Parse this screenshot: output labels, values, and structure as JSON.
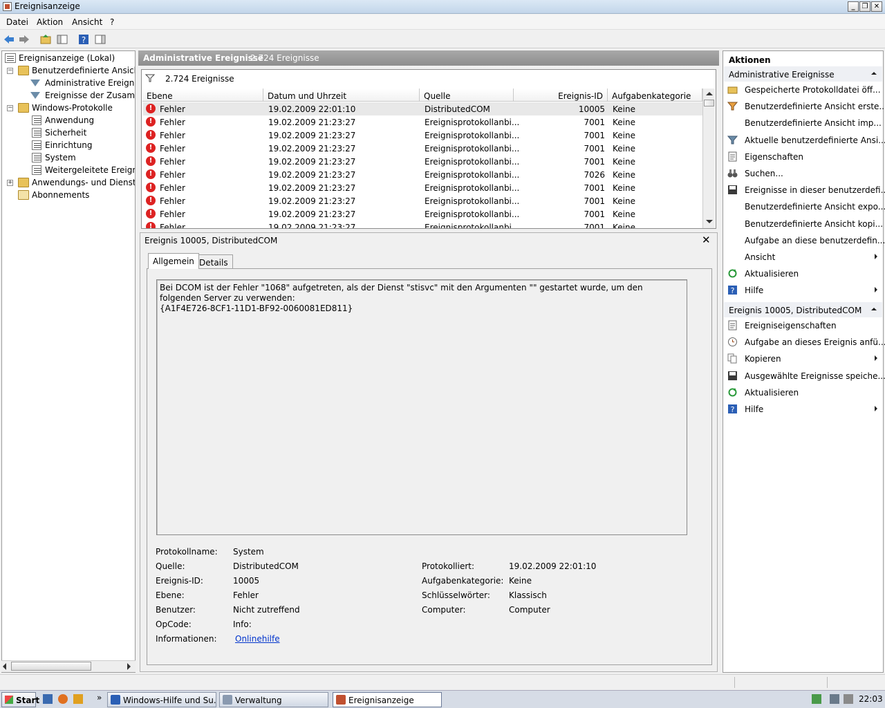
{
  "window": {
    "title": "Ereignisanzeige"
  },
  "menu": [
    "Datei",
    "Aktion",
    "Ansicht",
    "?"
  ],
  "tree": {
    "root": "Ereignisanzeige (Lokal)",
    "custom_views": "Benutzerdefinierte Ansichten",
    "admin_events": "Administrative Ereignisse",
    "summary_events": "Ereignisse der Zusammenfassung",
    "windows_logs": "Windows-Protokolle",
    "app": "Anwendung",
    "security": "Sicherheit",
    "setup": "Einrichtung",
    "system": "System",
    "forwarded": "Weitergeleitete Ereignisse",
    "app_services": "Anwendungs- und Dienstprotokolle",
    "subscriptions": "Abonnements"
  },
  "center": {
    "header_title": "Administrative Ereignisse",
    "header_count": "2.724 Ereignisse",
    "filter_count": "2.724 Ereignisse",
    "columns": [
      "Ebene",
      "Datum und Uhrzeit",
      "Quelle",
      "Ereignis-ID",
      "Aufgabenkategorie"
    ],
    "rows": [
      {
        "level": "Fehler",
        "date": "19.02.2009 22:01:10",
        "source": "DistributedCOM",
        "id": "10005",
        "cat": "Keine"
      },
      {
        "level": "Fehler",
        "date": "19.02.2009 21:23:27",
        "source": "Ereignisprotokollanbi...",
        "id": "7001",
        "cat": "Keine"
      },
      {
        "level": "Fehler",
        "date": "19.02.2009 21:23:27",
        "source": "Ereignisprotokollanbi...",
        "id": "7001",
        "cat": "Keine"
      },
      {
        "level": "Fehler",
        "date": "19.02.2009 21:23:27",
        "source": "Ereignisprotokollanbi...",
        "id": "7001",
        "cat": "Keine"
      },
      {
        "level": "Fehler",
        "date": "19.02.2009 21:23:27",
        "source": "Ereignisprotokollanbi...",
        "id": "7001",
        "cat": "Keine"
      },
      {
        "level": "Fehler",
        "date": "19.02.2009 21:23:27",
        "source": "Ereignisprotokollanbi...",
        "id": "7026",
        "cat": "Keine"
      },
      {
        "level": "Fehler",
        "date": "19.02.2009 21:23:27",
        "source": "Ereignisprotokollanbi...",
        "id": "7001",
        "cat": "Keine"
      },
      {
        "level": "Fehler",
        "date": "19.02.2009 21:23:27",
        "source": "Ereignisprotokollanbi...",
        "id": "7001",
        "cat": "Keine"
      },
      {
        "level": "Fehler",
        "date": "19.02.2009 21:23:27",
        "source": "Ereignisprotokollanbi...",
        "id": "7001",
        "cat": "Keine"
      },
      {
        "level": "Fehler",
        "date": "19.02.2009 21:23:27",
        "source": "Ereignisprotokollanbi...",
        "id": "7001",
        "cat": "Keine"
      }
    ]
  },
  "detail": {
    "title": "Ereignis 10005, DistributedCOM",
    "tabs": [
      "Allgemein",
      "Details"
    ],
    "description_line1": "Bei DCOM ist der Fehler \"1068\" aufgetreten, als der Dienst \"stisvc\" mit den Argumenten \"\" gestartet wurde, um den folgenden Server zu verwenden:",
    "description_line2": "{A1F4E726-8CF1-11D1-BF92-0060081ED811}",
    "props": {
      "log_name_label": "Protokollname:",
      "log_name": "System",
      "source_label": "Quelle:",
      "source": "DistributedCOM",
      "logged_label": "Protokolliert:",
      "logged": "19.02.2009 22:01:10",
      "event_id_label": "Ereignis-ID:",
      "event_id": "10005",
      "task_cat_label": "Aufgabenkategorie:",
      "task_cat": "Keine",
      "level_label": "Ebene:",
      "level": "Fehler",
      "keywords_label": "Schlüsselwörter:",
      "keywords": "Klassisch",
      "user_label": "Benutzer:",
      "user": "Nicht zutreffend",
      "computer_label": "Computer:",
      "computer": "Computer",
      "opcode_label": "OpCode:",
      "opcode": "Info:",
      "info_label": "Informationen:",
      "info_link": "Onlinehilfe"
    }
  },
  "actions": {
    "header": "Aktionen",
    "section1": "Administrative Ereignisse",
    "section1_items": [
      {
        "label": "Gespeicherte Protokolldatei öff...",
        "icon": "folder-open-icon"
      },
      {
        "label": "Benutzerdefinierte Ansicht erste...",
        "icon": "filter-new-icon"
      },
      {
        "label": "Benutzerdefinierte Ansicht imp...",
        "icon": ""
      },
      {
        "label": "Aktuelle benutzerdefinierte Ansi...",
        "icon": "filter-icon"
      },
      {
        "label": "Eigenschaften",
        "icon": "properties-icon"
      },
      {
        "label": "Suchen...",
        "icon": "binoculars-icon"
      },
      {
        "label": "Ereignisse in dieser benutzerdefi...",
        "icon": "save-icon"
      },
      {
        "label": "Benutzerdefinierte Ansicht expo...",
        "icon": ""
      },
      {
        "label": "Benutzerdefinierte Ansicht kopi...",
        "icon": ""
      },
      {
        "label": "Aufgabe an diese benutzerdefin...",
        "icon": ""
      },
      {
        "label": "Ansicht",
        "icon": "",
        "submenu": true
      },
      {
        "label": "Aktualisieren",
        "icon": "refresh-icon"
      },
      {
        "label": "Hilfe",
        "icon": "help-icon",
        "submenu": true
      }
    ],
    "section2": "Ereignis 10005, DistributedCOM",
    "section2_items": [
      {
        "label": "Ereigniseigenschaften",
        "icon": "properties-icon"
      },
      {
        "label": "Aufgabe an dieses Ereignis anfü...",
        "icon": "task-icon"
      },
      {
        "label": "Kopieren",
        "icon": "copy-icon",
        "submenu": true
      },
      {
        "label": "Ausgewählte Ereignisse speiche...",
        "icon": "save-icon"
      },
      {
        "label": "Aktualisieren",
        "icon": "refresh-icon"
      },
      {
        "label": "Hilfe",
        "icon": "help-icon",
        "submenu": true
      }
    ]
  },
  "taskbar": {
    "start": "Start",
    "tasks": [
      "Windows-Hilfe und Su...",
      "Verwaltung",
      "Ereignisanzeige"
    ],
    "clock": "22:03"
  }
}
